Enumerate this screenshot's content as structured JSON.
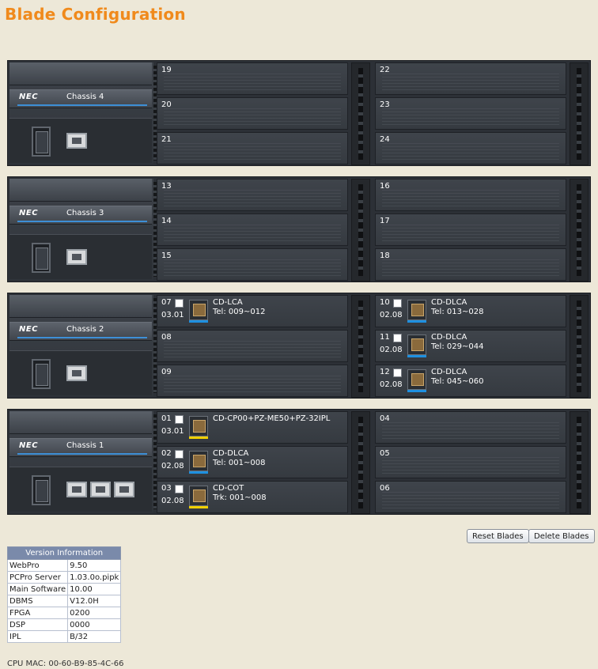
{
  "page": {
    "title": "Blade Configuration"
  },
  "chassis": [
    {
      "label": "Chassis 4",
      "slots": [
        {
          "num": "19"
        },
        {
          "num": "20"
        },
        {
          "num": "21"
        },
        {
          "num": "22"
        },
        {
          "num": "23"
        },
        {
          "num": "24"
        }
      ]
    },
    {
      "label": "Chassis 3",
      "slots": [
        {
          "num": "13"
        },
        {
          "num": "14"
        },
        {
          "num": "15"
        },
        {
          "num": "16"
        },
        {
          "num": "17"
        },
        {
          "num": "18"
        }
      ]
    },
    {
      "label": "Chassis 2",
      "slots": [
        {
          "num": "07",
          "ver": "03.01",
          "card": "CD-LCA",
          "tel": "Tel: 009~012"
        },
        {
          "num": "08"
        },
        {
          "num": "09"
        },
        {
          "num": "10",
          "ver": "02.08",
          "card": "CD-DLCA",
          "tel": "Tel: 013~028"
        },
        {
          "num": "11",
          "ver": "02.08",
          "card": "CD-DLCA",
          "tel": "Tel: 029~044"
        },
        {
          "num": "12",
          "ver": "02.08",
          "card": "CD-DLCA",
          "tel": "Tel: 045~060"
        }
      ]
    },
    {
      "label": "Chassis 1",
      "slots": [
        {
          "num": "01",
          "ver": "03.01",
          "card": "CD-CP00+PZ-ME50+PZ-32IPL",
          "tel": ""
        },
        {
          "num": "02",
          "ver": "02.08",
          "card": "CD-DLCA",
          "tel": "Tel: 001~008"
        },
        {
          "num": "03",
          "ver": "02.08",
          "card": "CD-COT",
          "tel": "Trk: 001~008"
        },
        {
          "num": "04"
        },
        {
          "num": "05"
        },
        {
          "num": "06"
        }
      ]
    }
  ],
  "brand": {
    "nec": "NEC"
  },
  "colors": {
    "accent": "#f08a1c",
    "blue_bar": "#1e90e0",
    "yellow_bar": "#f0d000"
  },
  "actions": {
    "reset": "Reset Blades",
    "delete": "Delete Blades"
  },
  "version_info": {
    "title": "Version Information",
    "rows": [
      {
        "k": "WebPro",
        "v": "9.50"
      },
      {
        "k": "PCPro Server",
        "v": "1.03.0o.pipk"
      },
      {
        "k": "Main Software",
        "v": "10.00"
      },
      {
        "k": "DBMS",
        "v": "V12.0H"
      },
      {
        "k": "FPGA",
        "v": "0200"
      },
      {
        "k": "DSP",
        "v": "0000"
      },
      {
        "k": "IPL",
        "v": "B/32"
      }
    ]
  },
  "cpu_mac": "CPU MAC: 00-60-B9-85-4C-66"
}
